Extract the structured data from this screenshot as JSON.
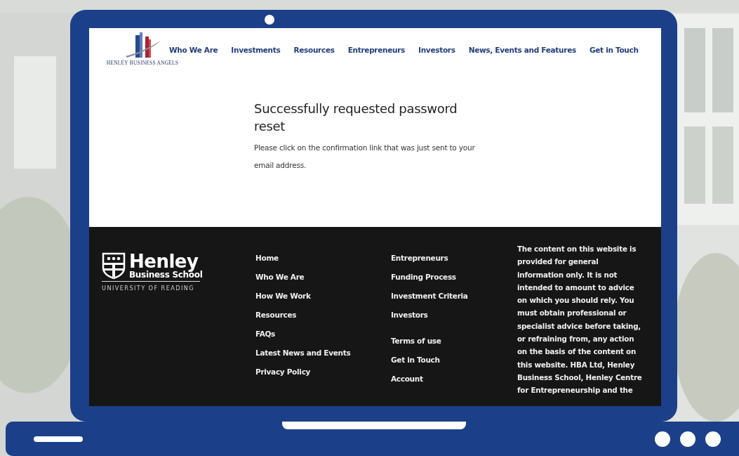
{
  "header": {
    "logo_text": "HENLEY BUSINESS ANGELS",
    "nav": [
      "Who We Are",
      "Investments",
      "Resources",
      "Entrepreneurs",
      "Investors",
      "News, Events and Features",
      "Get in Touch"
    ]
  },
  "main": {
    "heading": "Successfully requested password reset",
    "message": "Please click on the confirmation link that was just sent to your email address."
  },
  "footer": {
    "logo": {
      "name": "Henley",
      "subtitle": "Business School",
      "university": "UNIVERSITY OF READING"
    },
    "column_1": [
      [
        "Home",
        "Who We Are",
        "How We Work",
        "Resources",
        "FAQs",
        "Latest News and Events",
        "Privacy Policy"
      ]
    ],
    "column_2": [
      [
        "Entrepreneurs",
        "Funding Process",
        "Investment Criteria",
        "Investors"
      ],
      [
        "Terms of use",
        "Get in Touch",
        "Account"
      ]
    ],
    "disclaimer": "The content on this website is provided for general information only. It is not intended to amount to advice on which you should rely. You must obtain professional or specialist advice before taking, or refraining from, any action on the basis of the content on this website. HBA Ltd, Henley Business School, Henley Centre for Entrepreneurship and the"
  }
}
